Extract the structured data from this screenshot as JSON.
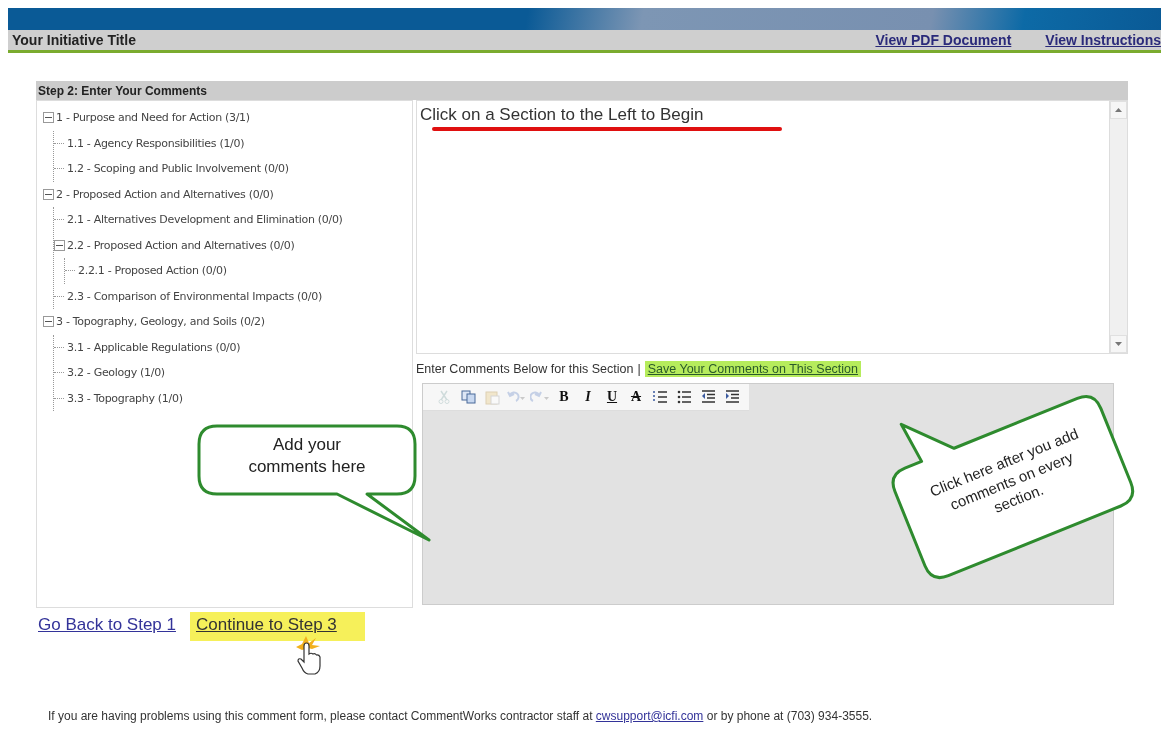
{
  "header": {
    "title": "Your Initiative Title",
    "links": [
      "View PDF Document",
      "View Instructions"
    ]
  },
  "step": {
    "title": "Step 2: Enter Your Comments"
  },
  "tree": [
    {
      "label": "1 - Purpose and Need for Action (3/1)",
      "expanded": true,
      "children": [
        {
          "label": "1.1 - Agency Responsibilities (1/0)"
        },
        {
          "label": "1.2 - Scoping and Public Involvement (0/0)"
        }
      ]
    },
    {
      "label": "2 - Proposed Action and Alternatives (0/0)",
      "expanded": true,
      "children": [
        {
          "label": "2.1 - Alternatives Development and Elimination (0/0)"
        },
        {
          "label": "2.2 - Proposed Action and Alternatives (0/0)",
          "expanded": true,
          "children": [
            {
              "label": "2.2.1 - Proposed Action (0/0)"
            }
          ]
        },
        {
          "label": "2.3 - Comparison of Environmental Impacts (0/0)"
        }
      ]
    },
    {
      "label": "3 - Topography, Geology, and Soils (0/2)",
      "expanded": true,
      "children": [
        {
          "label": "3.1 - Applicable Regulations (0/0)"
        },
        {
          "label": "3.2 - Geology (1/0)"
        },
        {
          "label": "3.3 - Topography (1/0)"
        }
      ]
    }
  ],
  "content": {
    "text": "Click on a Section to the Left to Begin"
  },
  "comment_bar": {
    "label": "Enter Comments Below for this Section",
    "separator": "|",
    "save_link": {
      "text": "Save Your Comments on This Section",
      "highlighted": true
    }
  },
  "toolbar": [
    {
      "kind": "cut",
      "disabled": true
    },
    {
      "kind": "copy",
      "disabled": false
    },
    {
      "kind": "paste",
      "disabled": true
    },
    {
      "kind": "undo",
      "disabled": true
    },
    {
      "kind": "redo",
      "disabled": true
    },
    {
      "kind": "bold",
      "label": "B",
      "disabled": false
    },
    {
      "kind": "italic",
      "label": "I",
      "disabled": false
    },
    {
      "kind": "underline",
      "label": "U",
      "disabled": false
    },
    {
      "kind": "strike",
      "label": "A",
      "disabled": false
    },
    {
      "kind": "ordered-list",
      "disabled": false
    },
    {
      "kind": "bullet-list",
      "disabled": false
    },
    {
      "kind": "outdent",
      "disabled": false
    },
    {
      "kind": "indent",
      "disabled": false
    }
  ],
  "nav_links": [
    {
      "text": "Go Back to Step 1",
      "highlighted": false
    },
    {
      "text": "Continue to Step 3",
      "highlighted": true
    }
  ],
  "callouts": [
    {
      "text": "Add your comments here",
      "kind": "left"
    },
    {
      "text": "Click here after you add comments on every section.",
      "kind": "right"
    }
  ],
  "footer": {
    "before": "If you are having problems using this comment form, please contact CommentWorks contractor staff at",
    "link": "cwsupport@icfi.com",
    "after": "or by phone at (703) 934-3555."
  }
}
